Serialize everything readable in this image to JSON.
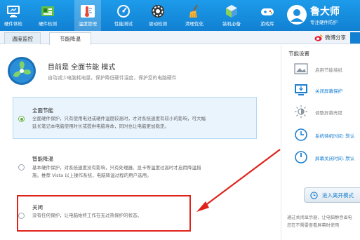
{
  "nav": {
    "items": [
      {
        "label": "硬件体检",
        "icon": "monitor-icon"
      },
      {
        "label": "硬件检测",
        "icon": "circuit-board-icon"
      },
      {
        "label": "温度管理",
        "icon": "thermometer-icon"
      },
      {
        "label": "性能测试",
        "icon": "speedometer-icon"
      },
      {
        "label": "驱动检测",
        "icon": "gear-icon"
      },
      {
        "label": "清理优化",
        "icon": "broom-icon"
      },
      {
        "label": "装机必备",
        "icon": "cube-icon"
      },
      {
        "label": "游戏库",
        "icon": "gamepad-icon"
      }
    ],
    "active_index": 2
  },
  "brand": {
    "title": "鲁大师",
    "subtitle": "专注硬件防护"
  },
  "tabs": [
    "温度监控",
    "节能降温"
  ],
  "active_tab": 1,
  "share_label": "微博分享",
  "main": {
    "headline": "目前是 全面节能 模式",
    "subline": "自动减少电脑耗电量，保护降低硬件温度，保护您的电脑硬件",
    "options": [
      {
        "title": "全面节能",
        "desc_line1": "全面硬件保护，只有使用电池或硬件温度较高时，才对系统速度有较小的影响，可大幅",
        "desc_line2": "延长笔记本电脑使用时长或提供电脑寿命，同时也让电脑更加稳定。",
        "selected": true
      },
      {
        "title": "智能降温",
        "desc_line1": "基本硬件保护，对系统速度没有影响，只有处理器、显卡等温度过高时才启用降温措",
        "desc_line2": "施。推荐 Vista 以上操作系统，电脑降温过程的用户选用。",
        "selected": false
      },
      {
        "title": "关闭",
        "desc_line1": "没有任何保护，让电脑始终工作在无过热保护的状态。",
        "desc_line2": "",
        "selected": false
      }
    ]
  },
  "side": {
    "title": "节能设置",
    "items": [
      {
        "label": "启用节能墙纸",
        "icon": "picture-icon",
        "link": false
      },
      {
        "label": "关闭屏幕保护",
        "icon": "monitor-download-icon",
        "link": true
      },
      {
        "label": "调整屏幕亮度",
        "icon": "brightness-icon",
        "link": false
      },
      {
        "label": "系统待机时间: 默认",
        "icon": "clock-icon",
        "link": true
      },
      {
        "label": "屏幕关闭时间: 默认",
        "icon": "power-icon",
        "link": true
      }
    ],
    "enter_button": "进入离开模式",
    "note_line1": "通过关闭显示器，让电脑静音省电",
    "note_line2": "您在不需要查看屏幕时使用"
  },
  "colors": {
    "nav_bg": "#1180d2",
    "accent_link": "#1b7fd0",
    "highlight_red": "#e0231a",
    "selected_bg": "#eaf4fd"
  }
}
